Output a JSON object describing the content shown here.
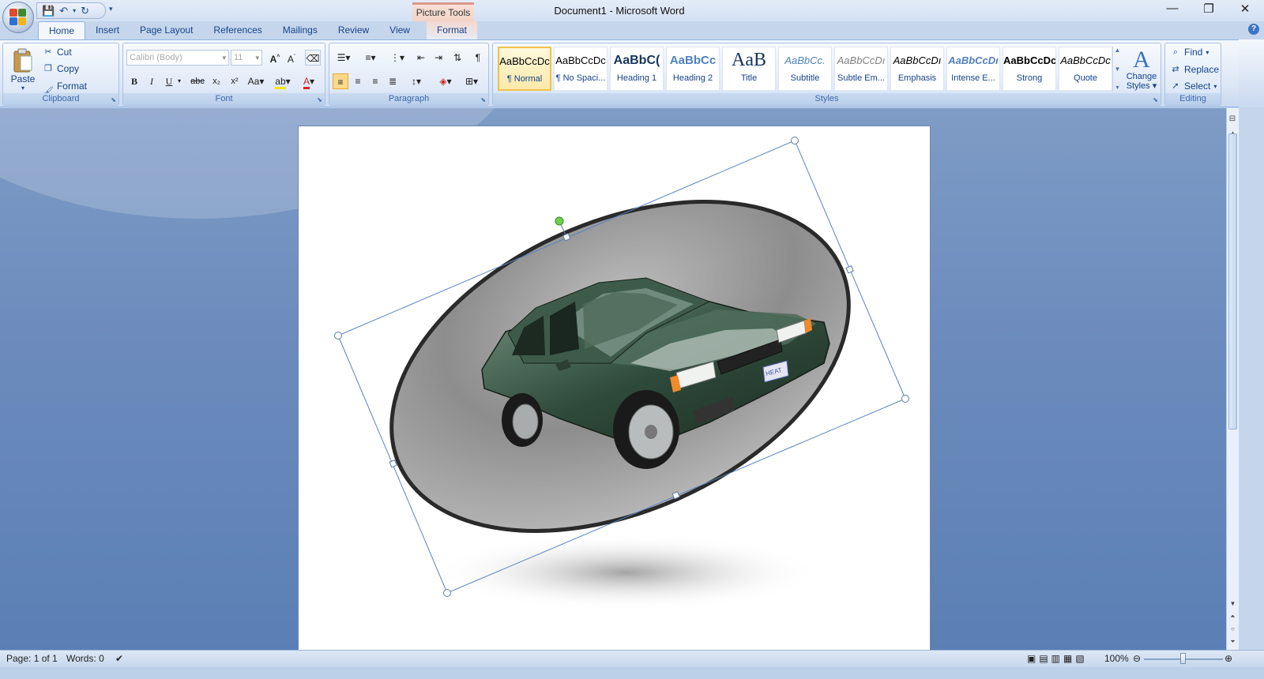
{
  "window": {
    "title": "Document1 - Microsoft Word",
    "contextual_tab_group": "Picture Tools"
  },
  "tabs": [
    "Home",
    "Insert",
    "Page Layout",
    "References",
    "Mailings",
    "Review",
    "View",
    "Format"
  ],
  "active_tab": "Home",
  "clipboard": {
    "label": "Clipboard",
    "paste": "Paste",
    "cut": "Cut",
    "copy": "Copy",
    "format_painter": "Format Painter"
  },
  "font": {
    "label": "Font",
    "font_name": "Calibri (Body)",
    "font_size": "11"
  },
  "paragraph": {
    "label": "Paragraph"
  },
  "styles": {
    "label": "Styles",
    "items": [
      {
        "preview": "AaBbCcDc",
        "name": "¶ Normal"
      },
      {
        "preview": "AaBbCcDc",
        "name": "¶ No Spaci..."
      },
      {
        "preview": "AaBbC(",
        "name": "Heading 1"
      },
      {
        "preview": "AaBbCc",
        "name": "Heading 2"
      },
      {
        "preview": "AaB",
        "name": "Title"
      },
      {
        "preview": "AaBbCc.",
        "name": "Subtitle"
      },
      {
        "preview": "AaBbCcDı",
        "name": "Subtle Em..."
      },
      {
        "preview": "AaBbCcDı",
        "name": "Emphasis"
      },
      {
        "preview": "AaBbCcDı",
        "name": "Intense E..."
      },
      {
        "preview": "AaBbCcDc",
        "name": "Strong"
      },
      {
        "preview": "AaBbCcDc",
        "name": "Quote"
      }
    ],
    "change_styles_line1": "Change",
    "change_styles_line2": "Styles"
  },
  "editing": {
    "label": "Editing",
    "find": "Find",
    "replace": "Replace",
    "select": "Select"
  },
  "status": {
    "page": "Page: 1 of 1",
    "words": "Words: 0",
    "zoom": "100%"
  },
  "picture": {
    "license_plate": "HEAT"
  },
  "colors": {
    "accent": "#15428b",
    "selected_style_border": "#f2c14a",
    "car_body": "#2f4a3b"
  }
}
